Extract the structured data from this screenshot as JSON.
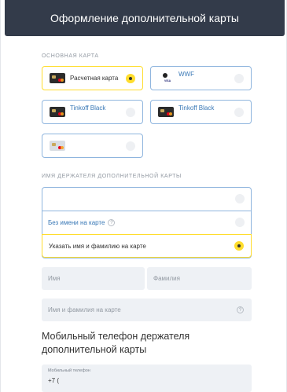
{
  "header": {
    "title": "Оформление дополнительной карты"
  },
  "main_card": {
    "label": "ОСНОВНАЯ КАРТА",
    "cards": [
      {
        "name": "Расчетная карта",
        "selected": true,
        "design": "black-mastercard"
      },
      {
        "name": "WWF",
        "selected": false,
        "design": "wwf-visa"
      },
      {
        "name": "Tinkoff Black",
        "selected": false,
        "design": "black-mastercard"
      },
      {
        "name": "Tinkoff Black",
        "selected": false,
        "design": "black-mastercard"
      },
      {
        "name": "",
        "selected": false,
        "design": "platinum-mastercard"
      }
    ]
  },
  "holder_name": {
    "label": "ИМЯ ДЕРЖАТЕЛЯ ДОПОЛНИТЕЛЬНОЙ КАРТЫ",
    "options": [
      {
        "label": "",
        "selected": false
      },
      {
        "label": "Без имени на карте",
        "help": "?",
        "selected": false
      },
      {
        "label": "Указать имя и фамилию на карте",
        "selected": true
      }
    ],
    "first_name_placeholder": "Имя",
    "last_name_placeholder": "Фамилия",
    "latin_name_placeholder": "Имя и фамилия на карте",
    "latin_name_help": "?"
  },
  "phone_section": {
    "title": "Мобильный телефон держателя дополнительной карты",
    "phone_label": "Мобильный телефон",
    "phone_value": "+7 ("
  },
  "colors": {
    "header_bg": "#333b4a",
    "accent_yellow": "#ffdd2d",
    "card_border": "#8fb5de",
    "link_blue": "#3978b6",
    "field_bg": "#eef1f5"
  }
}
